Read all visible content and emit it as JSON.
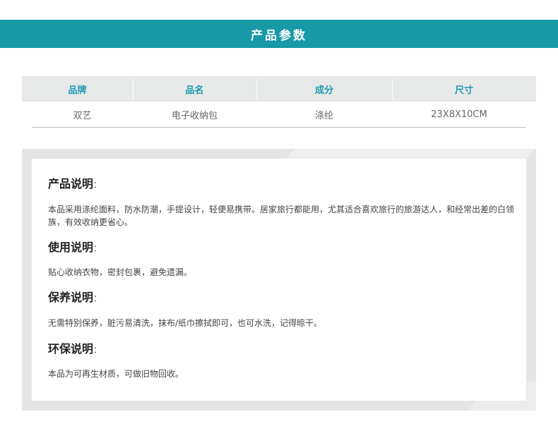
{
  "banner": {
    "title": "产品参数"
  },
  "params": {
    "headers": [
      "品牌",
      "品名",
      "成分",
      "尺寸"
    ],
    "values": [
      "双艺",
      "电子收纳包",
      "涤纶",
      "23X8X10CM"
    ]
  },
  "sections": [
    {
      "title": "产品说明",
      "colon": "：",
      "text": "本品采用涤纶面料，防水防潮，手提设计，轻便易携带。居家旅行都能用，尤其适合喜欢旅行的旅游达人，和经常出差的白领族，有效收纳更省心。"
    },
    {
      "title": "使用说明",
      "colon": "：",
      "text": "贴心收纳衣物，密封包裹，避免遗漏。"
    },
    {
      "title": "保养说明",
      "colon": "：",
      "text": "无需特别保养，脏污易清洗，抹布/纸巾擦拭即可，也可水洗，记得晾干。"
    },
    {
      "title": "环保说明",
      "colon": "：",
      "text": "本品为可再生材质，可做旧物回收。"
    }
  ]
}
